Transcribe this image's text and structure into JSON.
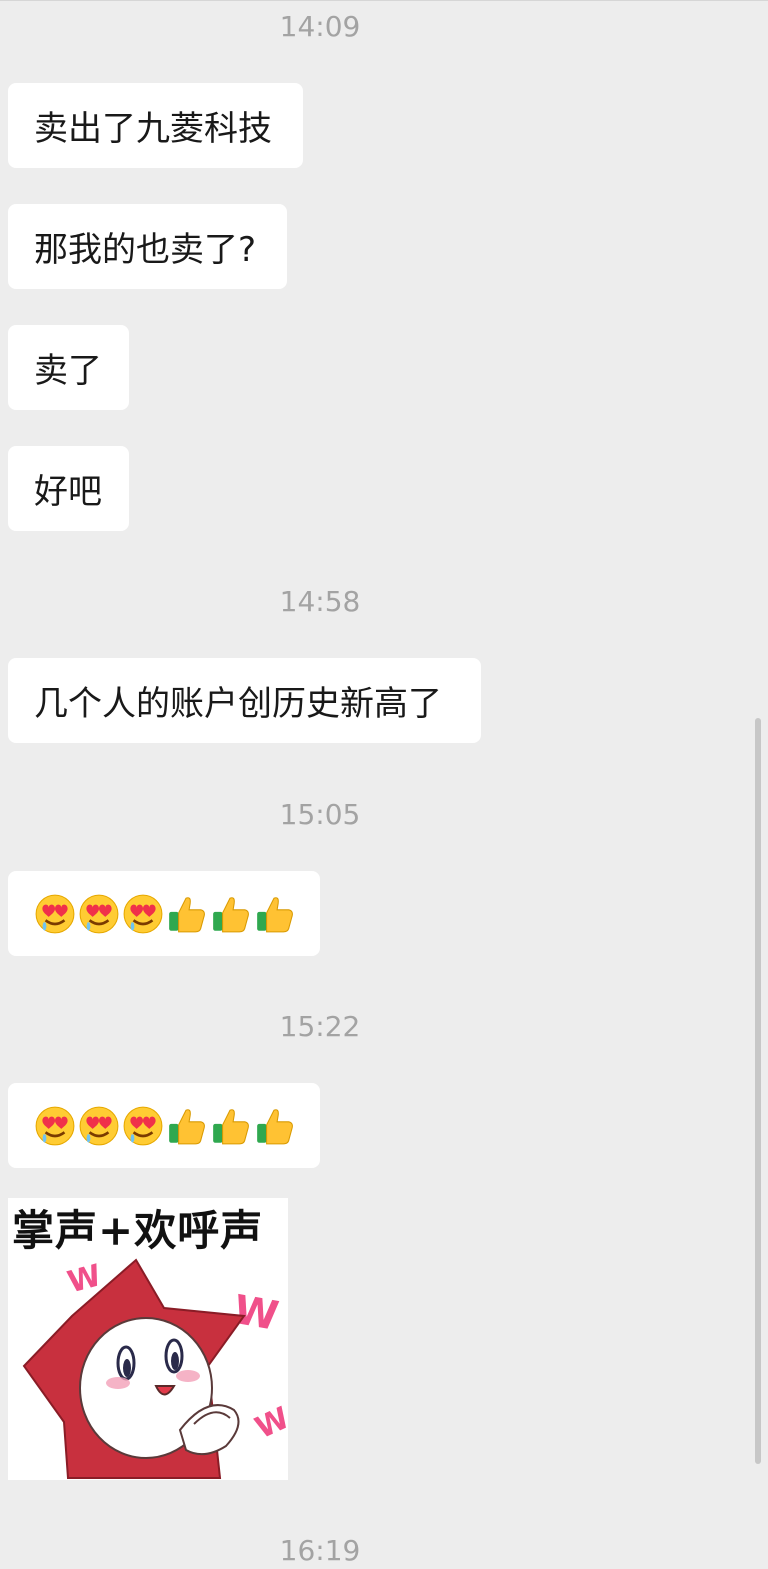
{
  "timestamps": {
    "t1": "14:09",
    "t2": "14:58",
    "t3": "15:05",
    "t4": "15:22",
    "t5": "16:19"
  },
  "messages": {
    "m1": "卖出了九菱科技",
    "m2": "那我的也卖了?",
    "m3": "卖了",
    "m4": "好吧",
    "m5": "几个人的账户创历史新高了"
  },
  "sticker": {
    "caption": "掌声+欢呼声"
  },
  "icons": {
    "emoji_1": "heart-eyes-drooling-emoji",
    "emoji_2": "thumbs-up-emoji"
  },
  "colors": {
    "background": "#ededed",
    "bubble": "#ffffff",
    "timestamp": "#a3a3a3",
    "sticker_star": "#c8303e"
  }
}
